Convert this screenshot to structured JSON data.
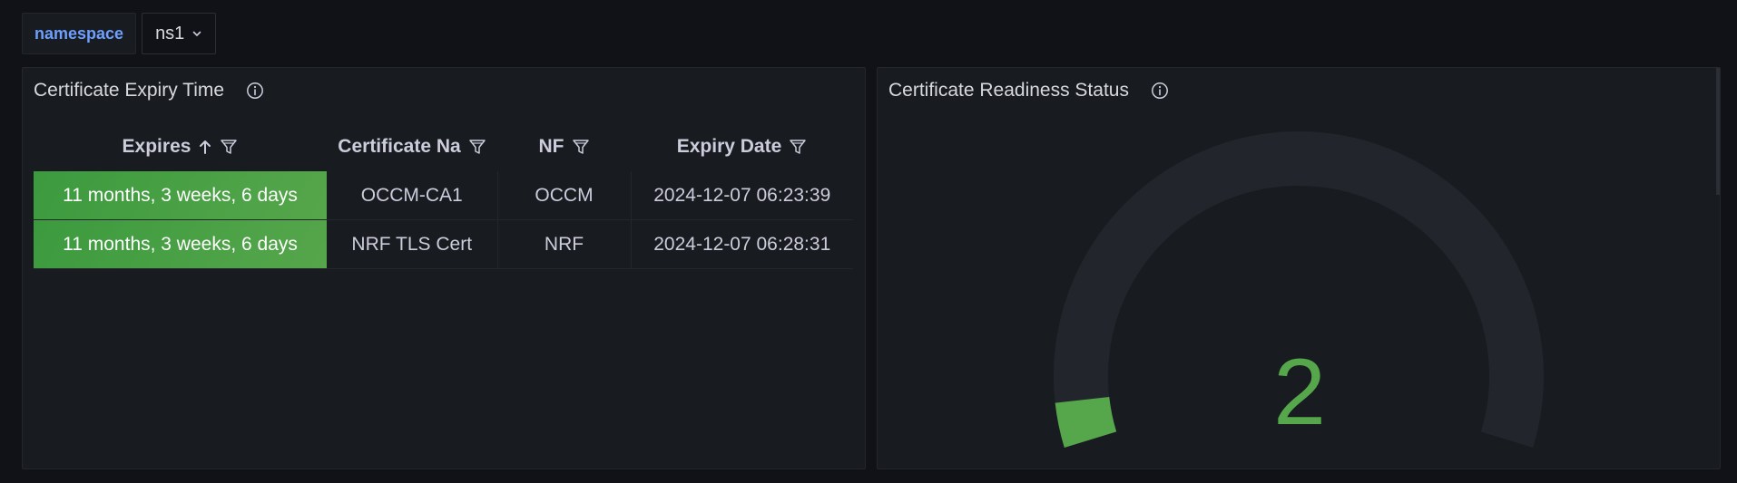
{
  "variables": {
    "namespace_label": "namespace",
    "namespace_value": "ns1"
  },
  "expiry_panel": {
    "title": "Certificate Expiry Time",
    "columns": {
      "expires": "Expires",
      "name": "Certificate Na",
      "nf": "NF",
      "date": "Expiry Date"
    },
    "rows": [
      {
        "expires": "11 months, 3 weeks, 6 days",
        "name": "OCCM-CA1",
        "nf": "OCCM",
        "date": "2024-12-07 06:23:39"
      },
      {
        "expires": "11 months, 3 weeks, 6 days",
        "name": "NRF TLS Cert",
        "nf": "NRF",
        "date": "2024-12-07 06:28:31"
      }
    ],
    "sort": "ascending"
  },
  "readiness_panel": {
    "title": "Certificate Readiness Status",
    "gauge_value": "2",
    "gauge_fraction": 0.05
  },
  "colors": {
    "background": "#111217",
    "panel": "#181b1f",
    "green": "#56a64b",
    "gauge_track": "#22252b",
    "accent_blue": "#6e9fff"
  }
}
